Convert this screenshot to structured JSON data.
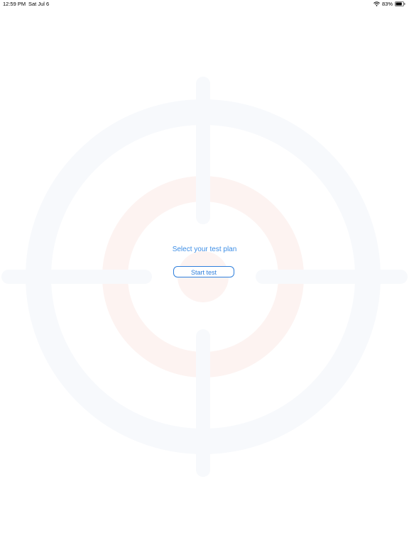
{
  "status_bar": {
    "time": "12:59 PM",
    "date": "Sat Jul 6",
    "battery_percent": "83%",
    "battery_level": 0.83,
    "wifi_icon": "wifi-icon",
    "battery_icon": "battery-icon"
  },
  "main": {
    "prompt": "Select your test plan",
    "start_button_label": "Start test"
  },
  "colors": {
    "accent": "#2f7fdc",
    "target_outer": "#f7f9fc",
    "target_inner": "#fdf3f1"
  }
}
